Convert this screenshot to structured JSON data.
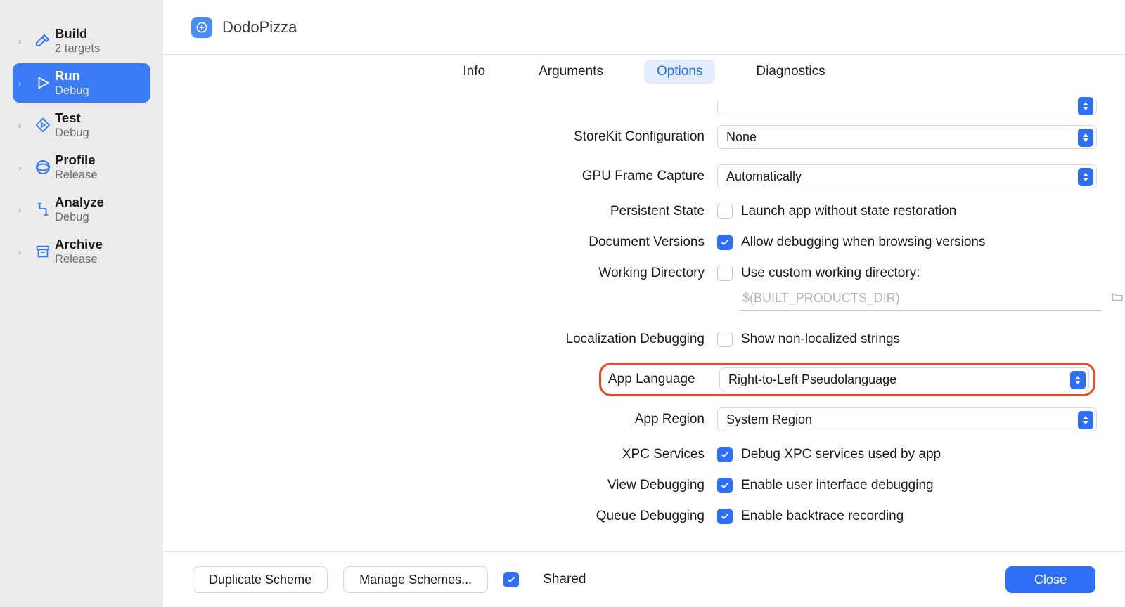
{
  "sidebar": {
    "items": [
      {
        "title": "Build",
        "sub": "2 targets"
      },
      {
        "title": "Run",
        "sub": "Debug"
      },
      {
        "title": "Test",
        "sub": "Debug"
      },
      {
        "title": "Profile",
        "sub": "Release"
      },
      {
        "title": "Analyze",
        "sub": "Debug"
      },
      {
        "title": "Archive",
        "sub": "Release"
      }
    ],
    "selected_index": 1
  },
  "header": {
    "app_name": "DodoPizza"
  },
  "tabs": {
    "items": [
      "Info",
      "Arguments",
      "Options",
      "Diagnostics"
    ],
    "active_index": 2
  },
  "options": {
    "storekit": {
      "label": "StoreKit Configuration",
      "value": "None"
    },
    "gpu": {
      "label": "GPU Frame Capture",
      "value": "Automatically"
    },
    "persistent": {
      "label": "Persistent State",
      "text": "Launch app without state restoration",
      "checked": false
    },
    "docversions": {
      "label": "Document Versions",
      "text": "Allow debugging when browsing versions",
      "checked": true
    },
    "workdir": {
      "label": "Working Directory",
      "text": "Use custom working directory:",
      "checked": false,
      "placeholder": "$(BUILT_PRODUCTS_DIR)"
    },
    "locdebug": {
      "label": "Localization Debugging",
      "text": "Show non-localized strings",
      "checked": false
    },
    "applang": {
      "label": "App Language",
      "value": "Right-to-Left Pseudolanguage"
    },
    "appregion": {
      "label": "App Region",
      "value": "System Region"
    },
    "xpc": {
      "label": "XPC Services",
      "text": "Debug XPC services used by app",
      "checked": true
    },
    "viewdbg": {
      "label": "View Debugging",
      "text": "Enable user interface debugging",
      "checked": true
    },
    "queuedbg": {
      "label": "Queue Debugging",
      "text": "Enable backtrace recording",
      "checked": true
    }
  },
  "footer": {
    "duplicate": "Duplicate Scheme",
    "manage": "Manage Schemes...",
    "shared_label": "Shared",
    "shared_checked": true,
    "close": "Close"
  }
}
